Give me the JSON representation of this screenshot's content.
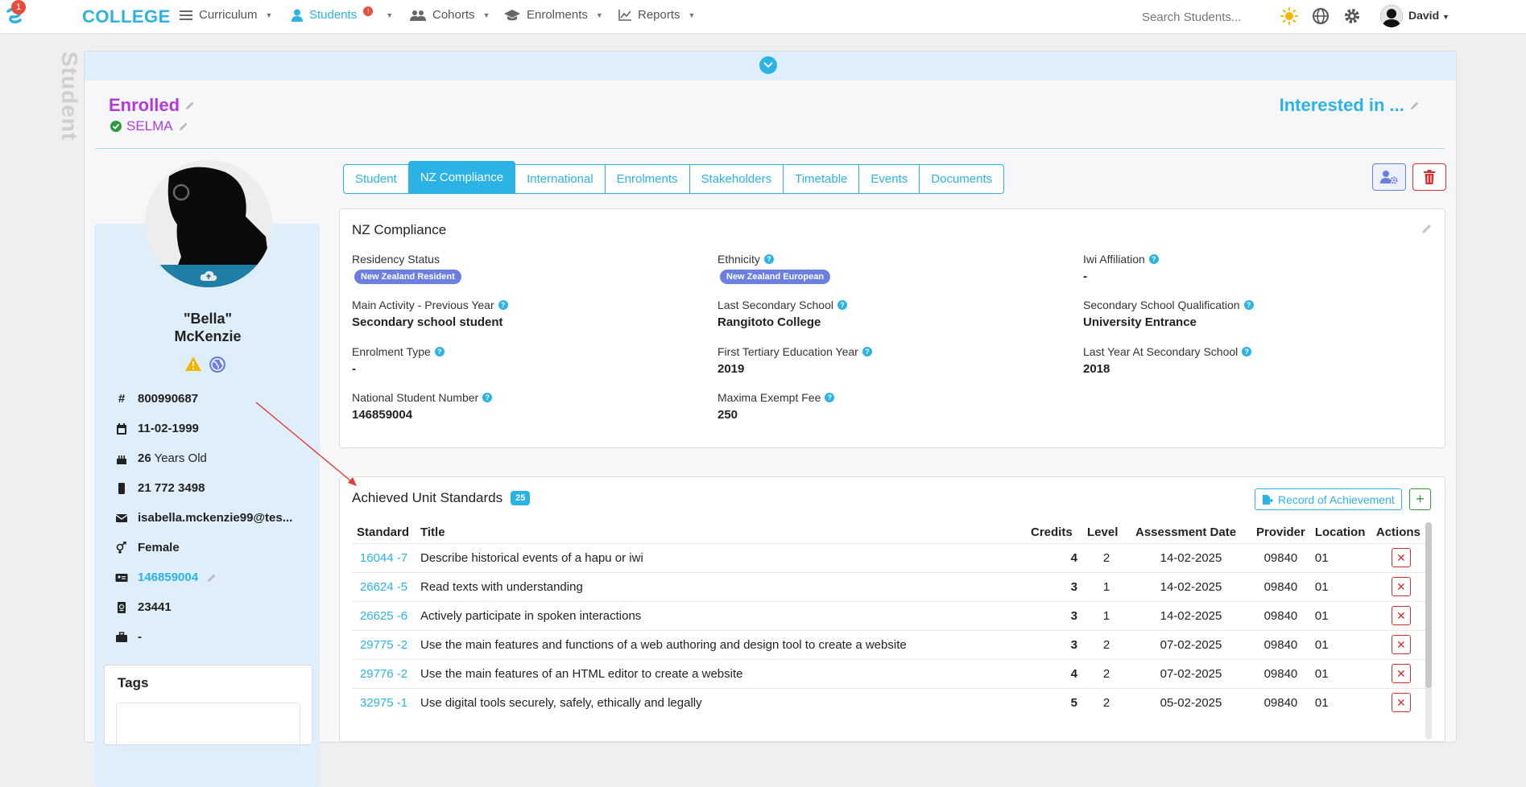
{
  "nav": {
    "badge_count": "1",
    "brand": "COLLEGE",
    "items": [
      {
        "label": "Curriculum",
        "icon": "bars-icon"
      },
      {
        "label": "Students",
        "icon": "user-icon",
        "alert": "!"
      },
      {
        "label": "Cohorts",
        "icon": "users-icon"
      },
      {
        "label": "Enrolments",
        "icon": "graduation-cap-icon"
      },
      {
        "label": "Reports",
        "icon": "line-chart-icon"
      }
    ],
    "search_placeholder": "Search Students...",
    "user_name": "David"
  },
  "page": {
    "vertical_label": "Student",
    "status_title": "Enrolled",
    "status_sub": "SELMA",
    "interested": "Interested in ..."
  },
  "profile": {
    "nickname": "\"Bella\"",
    "surname": "McKenzie",
    "student_id": "800990687",
    "dob": "11-02-1999",
    "age_number": "26",
    "age_suffix": " Years Old",
    "phone": "21 772 3498",
    "email": "isabella.mckenzie99@tes...",
    "gender": "Female",
    "nsn": "146859004",
    "passport": "23441",
    "employer": "-",
    "tags_title": "Tags"
  },
  "tabs": [
    {
      "label": "Student",
      "active": false
    },
    {
      "label": "NZ Compliance",
      "active": true
    },
    {
      "label": "International",
      "active": false
    },
    {
      "label": "Enrolments",
      "active": false
    },
    {
      "label": "Stakeholders",
      "active": false
    },
    {
      "label": "Timetable",
      "active": false
    },
    {
      "label": "Events",
      "active": false
    },
    {
      "label": "Documents",
      "active": false
    }
  ],
  "compliance": {
    "title": "NZ Compliance",
    "fields": {
      "residency_label": "Residency Status",
      "residency_value": "New Zealand Resident",
      "ethnicity_label": "Ethnicity",
      "ethnicity_value": "New Zealand European",
      "iwi_label": "Iwi Affiliation",
      "iwi_value": "-",
      "main_activity_label": "Main Activity - Previous Year",
      "main_activity_value": "Secondary school student",
      "last_school_label": "Last Secondary School",
      "last_school_value": "Rangitoto College",
      "school_qual_label": "Secondary School Qualification",
      "school_qual_value": "University Entrance",
      "enrolment_type_label": "Enrolment Type",
      "enrolment_type_value": "-",
      "first_tertiary_label": "First Tertiary Education Year",
      "first_tertiary_value": "2019",
      "last_year_school_label": "Last Year At Secondary School",
      "last_year_school_value": "2018",
      "nsn_label": "National Student Number",
      "nsn_value": "146859004",
      "maxima_label": "Maxima Exempt Fee",
      "maxima_value": "250"
    }
  },
  "units": {
    "title": "Achieved Unit Standards",
    "count": "25",
    "roa_label": "Record of Achievement",
    "add_label": "+",
    "headers": [
      "Standard",
      "Title",
      "Credits",
      "Level",
      "Assessment Date",
      "Provider",
      "Location",
      "Actions"
    ],
    "rows": [
      {
        "standard": "16044 -7",
        "title": "Describe historical events of a hapu or iwi",
        "credits": "4",
        "level": "2",
        "date": "14-02-2025",
        "provider": "09840",
        "location": "01"
      },
      {
        "standard": "26624 -5",
        "title": "Read texts with understanding",
        "credits": "3",
        "level": "1",
        "date": "14-02-2025",
        "provider": "09840",
        "location": "01"
      },
      {
        "standard": "26625 -6",
        "title": "Actively participate in spoken interactions",
        "credits": "3",
        "level": "1",
        "date": "14-02-2025",
        "provider": "09840",
        "location": "01"
      },
      {
        "standard": "29775 -2",
        "title": "Use the main features and functions of a web authoring and design tool to create a website",
        "credits": "3",
        "level": "2",
        "date": "07-02-2025",
        "provider": "09840",
        "location": "01"
      },
      {
        "standard": "29776 -2",
        "title": "Use the main features of an HTML editor to create a website",
        "credits": "4",
        "level": "2",
        "date": "07-02-2025",
        "provider": "09840",
        "location": "01"
      },
      {
        "standard": "32975 -1",
        "title": "Use digital tools securely, safely, ethically and legally",
        "credits": "5",
        "level": "2",
        "date": "05-02-2025",
        "provider": "09840",
        "location": "01"
      }
    ],
    "remove_glyph": "✕"
  },
  "colors": {
    "accent": "#2bb3e6",
    "status_purple": "#b23bd6",
    "danger": "#d32f2f",
    "pill": "#6b7fe0"
  }
}
